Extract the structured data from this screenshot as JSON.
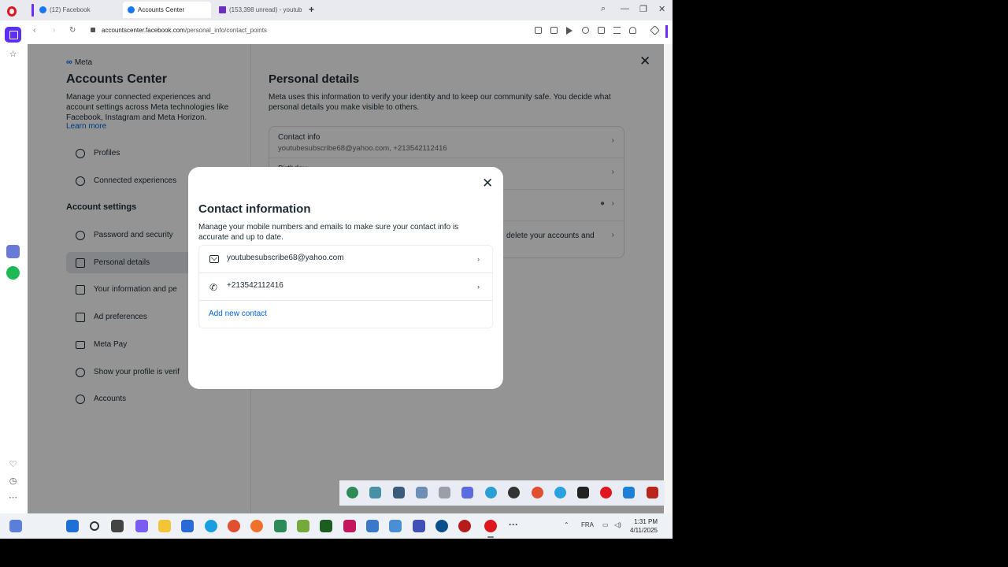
{
  "browser": {
    "tabs": [
      {
        "label": "(12) Facebook",
        "icon": "facebook-icon"
      },
      {
        "label": "Accounts Center",
        "icon": "facebook-icon",
        "active": true
      },
      {
        "label": "(153,398 unread) - youtub",
        "icon": "mail-icon"
      }
    ],
    "url_domain": "accountscenter.facebook.com",
    "url_path": "/personal_info/contact_points"
  },
  "accounts_center": {
    "brand": "Meta",
    "title": "Accounts Center",
    "description": "Manage your connected experiences and account settings across Meta technologies like Facebook, Instagram and Meta Horizon.",
    "learn_more": "Learn more",
    "nav_top": [
      {
        "label": "Profiles",
        "icon": "person-icon"
      },
      {
        "label": "Connected experiences",
        "icon": "connected-icon"
      }
    ],
    "section_heading": "Account settings",
    "nav_settings": [
      {
        "label": "Password and security",
        "icon": "shield-icon"
      },
      {
        "label": "Personal details",
        "icon": "id-card-icon",
        "active": true
      },
      {
        "label": "Your information and pe",
        "icon": "document-icon"
      },
      {
        "label": "Ad preferences",
        "icon": "megaphone-icon"
      },
      {
        "label": "Meta Pay",
        "icon": "card-icon"
      },
      {
        "label": "Show your profile is verif",
        "icon": "verified-icon"
      },
      {
        "label": "Accounts",
        "icon": "account-circle-icon"
      }
    ]
  },
  "personal_details": {
    "title": "Personal details",
    "description": "Meta uses this information to verify your identity and to keep our community safe. You decide what personal details you make visible to others.",
    "rows": [
      {
        "label": "Contact info",
        "value": "youtubesubscribe68@yahoo.com, +213542112416"
      },
      {
        "label": "Birthday",
        "value": ""
      },
      {
        "label": "",
        "value": ""
      },
      {
        "label": "delete your accounts and",
        "value": ""
      }
    ]
  },
  "dialog": {
    "title": "Contact information",
    "description": "Manage your mobile numbers and emails to make sure your contact info is accurate and up to date.",
    "contacts": [
      {
        "value": "youtubesubscribe68@yahoo.com",
        "icon": "mail-icon"
      },
      {
        "value": "+213542112416",
        "icon": "phone-icon"
      }
    ],
    "add_contact": "Add new contact"
  },
  "taskbar": {
    "language": "FRA",
    "time": "1:31 PM",
    "date": "4/11/2025"
  },
  "colors": {
    "accent": "#0064e0",
    "opera_red": "#e0161e",
    "opera_purple": "#5a2ef3"
  }
}
